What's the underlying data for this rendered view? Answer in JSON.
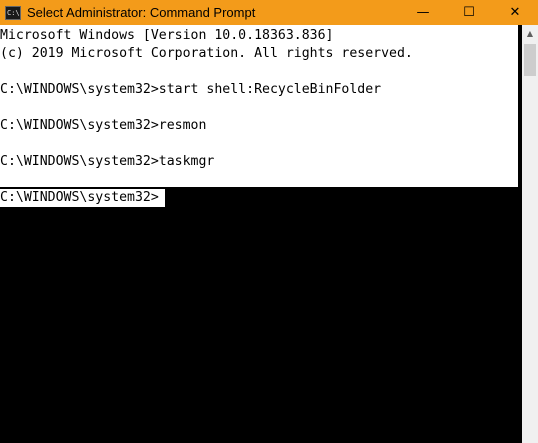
{
  "window": {
    "title": "Select Administrator: Command Prompt",
    "icon": "cmd-icon",
    "icon_text": "C:\\",
    "controls": {
      "minimize": "—",
      "maximize": "☐",
      "close": "✕"
    },
    "colors": {
      "titlebar": "#f39b1a",
      "console_bg": "#000000",
      "selection": "#ffffff"
    }
  },
  "console": {
    "lines": [
      "Microsoft Windows [Version 10.0.18363.836]",
      "(c) 2019 Microsoft Corporation. All rights reserved.",
      "",
      "C:\\WINDOWS\\system32>start shell:RecycleBinFolder",
      "",
      "C:\\WINDOWS\\system32>resmon",
      "",
      "C:\\WINDOWS\\system32>taskmgr",
      ""
    ],
    "prompt": "C:\\WINDOWS\\system32>"
  },
  "scrollbar": {
    "up_arrow": "▲"
  }
}
